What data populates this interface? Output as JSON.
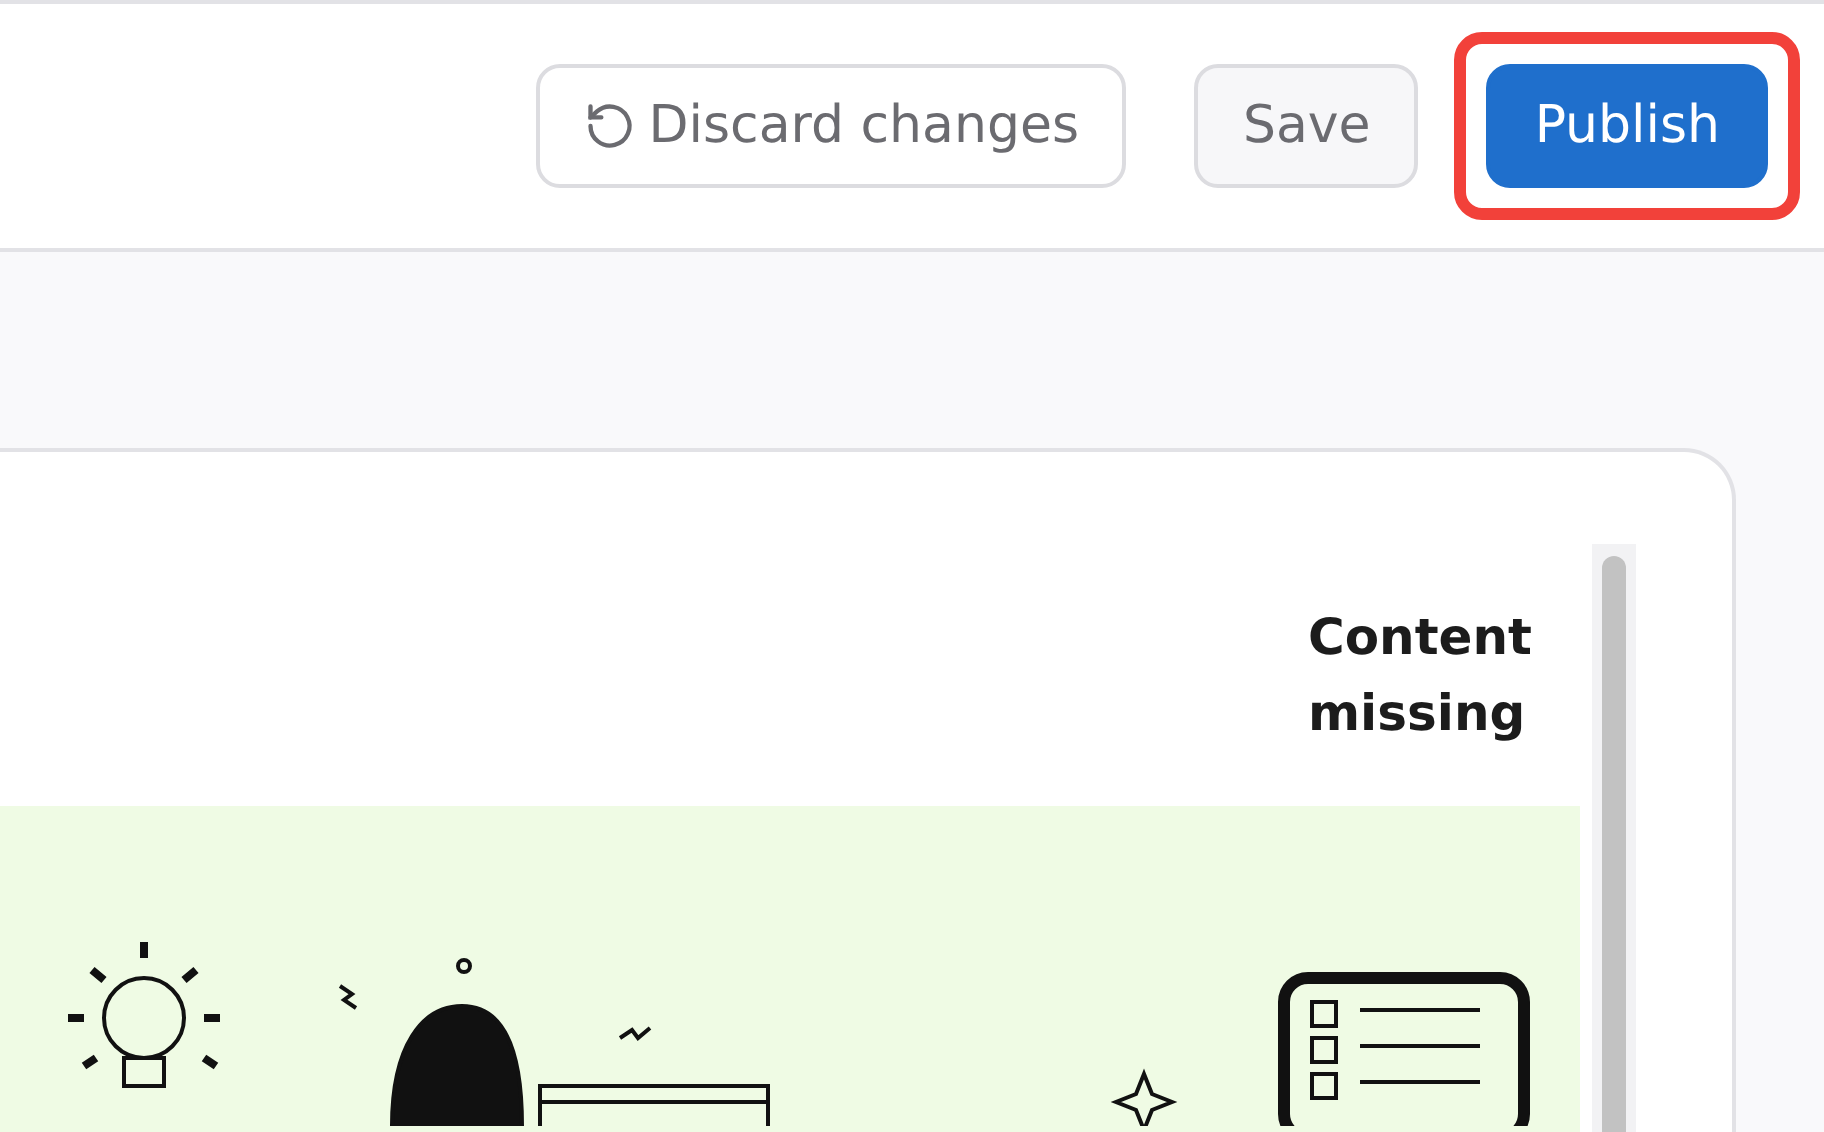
{
  "toolbar": {
    "buttons": [
      {
        "kind": "discard",
        "label": "Discard changes",
        "highlighted": false
      },
      {
        "kind": "save",
        "label": "Save",
        "highlighted": false
      },
      {
        "kind": "publish",
        "label": "Publish",
        "highlighted": true
      }
    ]
  },
  "preview": {
    "status": "Content missing"
  }
}
